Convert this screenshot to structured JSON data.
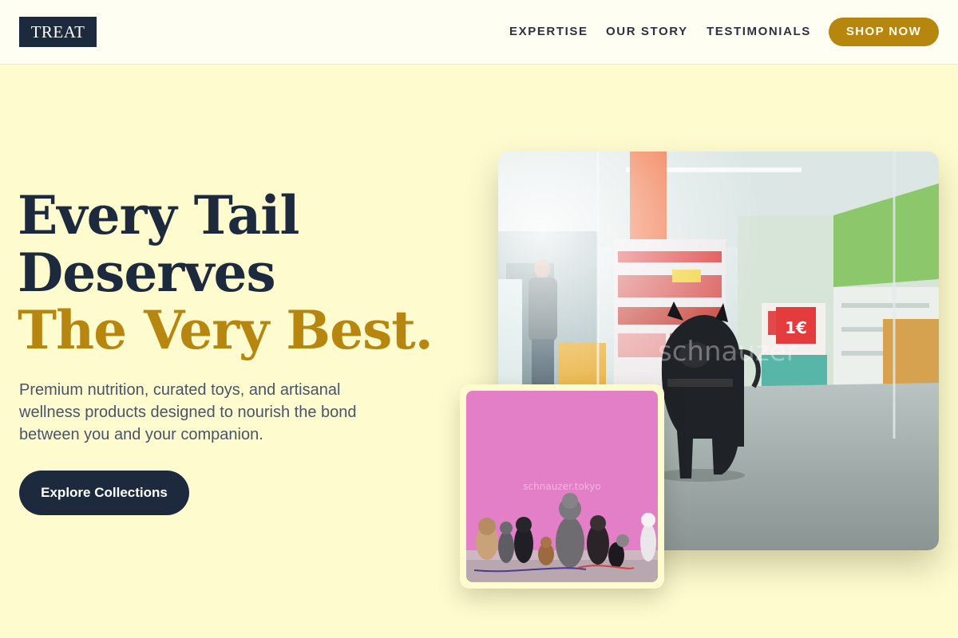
{
  "brand": {
    "logo_text": "TREAT"
  },
  "nav": {
    "links": [
      "EXPERTISE",
      "OUR STORY",
      "TESTIMONIALS"
    ],
    "cta_label": "SHOP NOW"
  },
  "hero": {
    "headline_line1": "Every Tail",
    "headline_line2": "Deserves",
    "headline_accent": "The Very Best.",
    "description": "Premium nutrition, curated toys, and artisanal wellness products designed to nourish the bond between you and your companion.",
    "cta_label": "Explore Collections"
  },
  "images": {
    "main_photo": {
      "subject": "French bulldog standing in pet store aisle",
      "watermark": "schnauzer",
      "price_sign": "1€"
    },
    "inset_photo": {
      "subject": "group of dogs sitting in front of pink wall",
      "watermark": "schnauzer.tokyo"
    }
  },
  "colors": {
    "page_bg": "#fefccf",
    "header_bg": "#fffef2",
    "navy": "#1d2a3d",
    "gold": "#b7860f",
    "body_text": "#4a5468"
  }
}
